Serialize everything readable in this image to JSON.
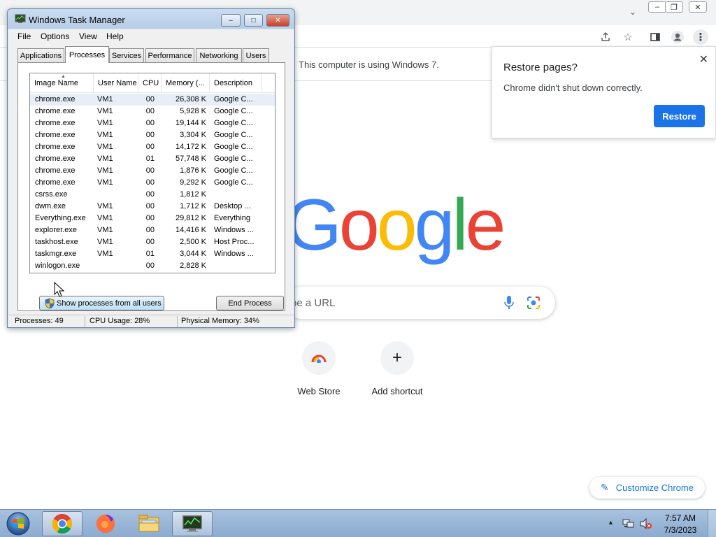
{
  "chrome": {
    "infobar_text": "This computer is using Windows 7.",
    "restore_popup": {
      "title": "Restore pages?",
      "message": "Chrome didn't shut down correctly.",
      "button": "Restore"
    },
    "search_placeholder": "pe a URL",
    "shortcuts": [
      {
        "label": "Web Store",
        "icon": "web-store-icon"
      },
      {
        "label": "Add shortcut",
        "icon": "plus-icon"
      }
    ],
    "customize_label": "Customize Chrome",
    "logo_letters": [
      {
        "ch": "o",
        "color": "#ea4335"
      },
      {
        "ch": "o",
        "color": "#fbbc05"
      },
      {
        "ch": "g",
        "color": "#4285f4"
      },
      {
        "ch": "l",
        "color": "#34a853"
      },
      {
        "ch": "e",
        "color": "#ea4335"
      }
    ],
    "accent": "#1a73e8"
  },
  "taskmgr": {
    "title": "Windows Task Manager",
    "menu": [
      "File",
      "Options",
      "View",
      "Help"
    ],
    "tabs": [
      "Applications",
      "Processes",
      "Services",
      "Performance",
      "Networking",
      "Users"
    ],
    "active_tab": "Processes",
    "columns": [
      "Image Name",
      "User Name",
      "CPU",
      "Memory (...",
      "Description"
    ],
    "rows": [
      {
        "image": "chrome.exe",
        "user": "VM1",
        "cpu": "00",
        "mem": "26,308 K",
        "desc": "Google C..."
      },
      {
        "image": "chrome.exe",
        "user": "VM1",
        "cpu": "00",
        "mem": "5,928 K",
        "desc": "Google C..."
      },
      {
        "image": "chrome.exe",
        "user": "VM1",
        "cpu": "00",
        "mem": "19,144 K",
        "desc": "Google C..."
      },
      {
        "image": "chrome.exe",
        "user": "VM1",
        "cpu": "00",
        "mem": "3,304 K",
        "desc": "Google C..."
      },
      {
        "image": "chrome.exe",
        "user": "VM1",
        "cpu": "00",
        "mem": "14,172 K",
        "desc": "Google C..."
      },
      {
        "image": "chrome.exe",
        "user": "VM1",
        "cpu": "01",
        "mem": "57,748 K",
        "desc": "Google C..."
      },
      {
        "image": "chrome.exe",
        "user": "VM1",
        "cpu": "00",
        "mem": "1,876 K",
        "desc": "Google C..."
      },
      {
        "image": "chrome.exe",
        "user": "VM1",
        "cpu": "00",
        "mem": "9,292 K",
        "desc": "Google C..."
      },
      {
        "image": "csrss.exe",
        "user": "",
        "cpu": "00",
        "mem": "1,812 K",
        "desc": ""
      },
      {
        "image": "dwm.exe",
        "user": "VM1",
        "cpu": "00",
        "mem": "1,712 K",
        "desc": "Desktop ..."
      },
      {
        "image": "Everything.exe",
        "user": "VM1",
        "cpu": "00",
        "mem": "29,812 K",
        "desc": "Everything"
      },
      {
        "image": "explorer.exe",
        "user": "VM1",
        "cpu": "00",
        "mem": "14,416 K",
        "desc": "Windows ..."
      },
      {
        "image": "taskhost.exe",
        "user": "VM1",
        "cpu": "00",
        "mem": "2,500 K",
        "desc": "Host Proc..."
      },
      {
        "image": "taskmgr.exe",
        "user": "VM1",
        "cpu": "01",
        "mem": "3,044 K",
        "desc": "Windows ..."
      },
      {
        "image": "winlogon.exe",
        "user": "",
        "cpu": "00",
        "mem": "2,828 K",
        "desc": ""
      }
    ],
    "show_all_label": "Show processes from all users",
    "end_process_label": "End Process",
    "status": {
      "processes": "Processes: 49",
      "cpu": "CPU Usage: 28%",
      "memory": "Physical Memory: 34%"
    }
  },
  "taskbar": {
    "apps": [
      "chrome-icon",
      "firefox-icon",
      "file-explorer-icon",
      "task-manager-icon"
    ],
    "time": "7:57 AM",
    "date": "7/3/2023"
  }
}
